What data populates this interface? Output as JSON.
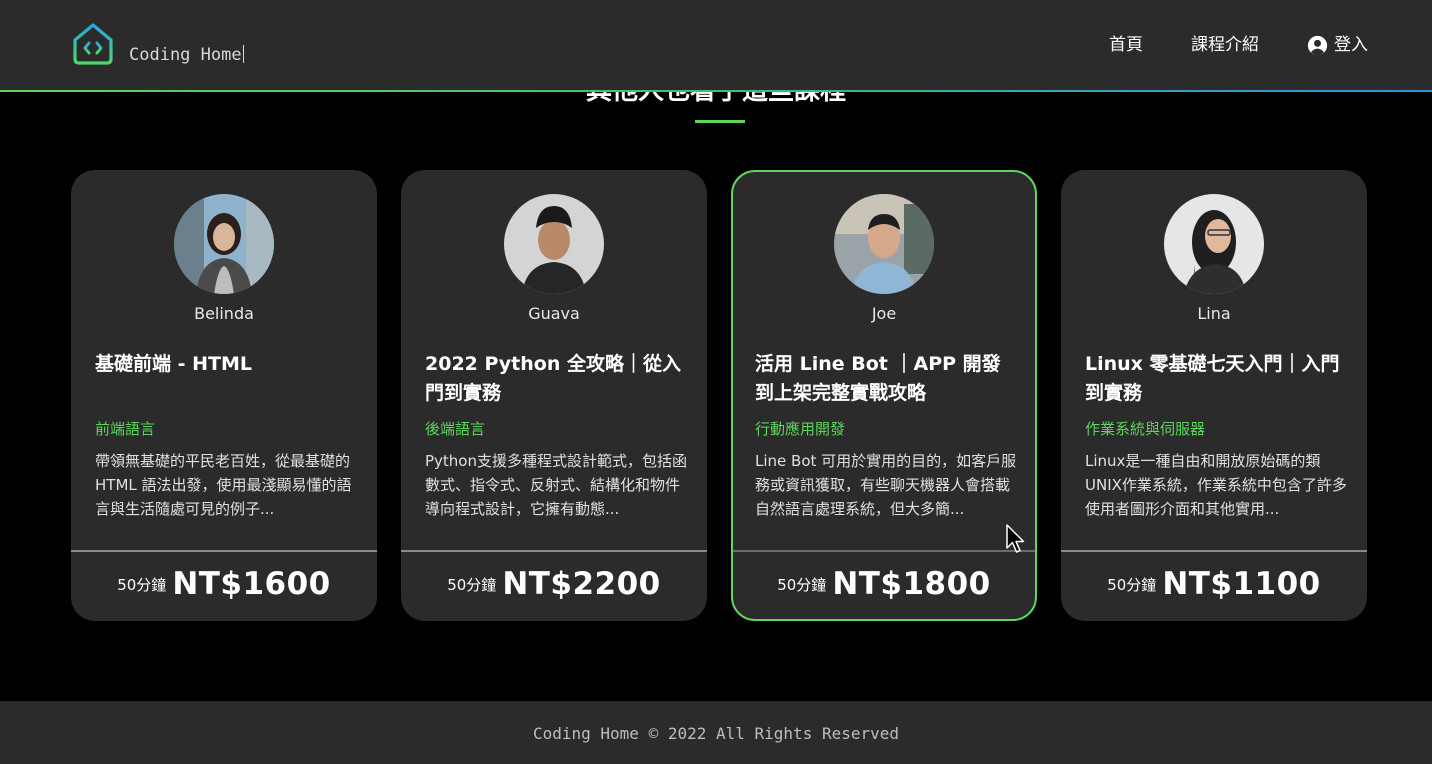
{
  "header": {
    "logo_text": "Coding Home",
    "nav": [
      {
        "label": "首頁"
      },
      {
        "label": "課程介紹"
      },
      {
        "label": "登入"
      }
    ]
  },
  "section": {
    "title": "其他人也看了這些課程"
  },
  "colors": {
    "accent": "#5cd65c",
    "card_bg": "#2b2b2b",
    "page_bg": "#000000"
  },
  "courses": [
    {
      "teacher": "Belinda",
      "title": "基礎前端 - HTML",
      "category": "前端語言",
      "description": "帶領無基礎的平民老百姓，從最基礎的 HTML 語法出發，使用最淺顯易懂的語言與生活隨處可見的例子...",
      "duration": "50分鐘",
      "price": "NT$1600"
    },
    {
      "teacher": "Guava",
      "title": "2022 Python 全攻略｜從入門到實務",
      "category": "後端語言",
      "description": "Python支援多種程式設計範式，包括函數式、指令式、反射式、結構化和物件導向程式設計，它擁有動態...",
      "duration": "50分鐘",
      "price": "NT$2200"
    },
    {
      "teacher": "Joe",
      "title": "活用 Line Bot ｜APP 開發到上架完整實戰攻略",
      "category": "行動應用開發",
      "description": "Line Bot 可用於實用的目的，如客戶服務或資訊獲取，有些聊天機器人會搭載自然語言處理系統，但大多簡...",
      "duration": "50分鐘",
      "price": "NT$1800"
    },
    {
      "teacher": "Lina",
      "title": "Linux 零基礎七天入門｜入門到實務",
      "category": "作業系統與伺服器",
      "description": "Linux是一種自由和開放原始碼的類UNIX作業系統，作業系統中包含了許多使用者圖形介面和其他實用...",
      "duration": "50分鐘",
      "price": "NT$1100"
    }
  ],
  "footer": {
    "copyright": "Coding Home © 2022 All Rights Reserved"
  }
}
